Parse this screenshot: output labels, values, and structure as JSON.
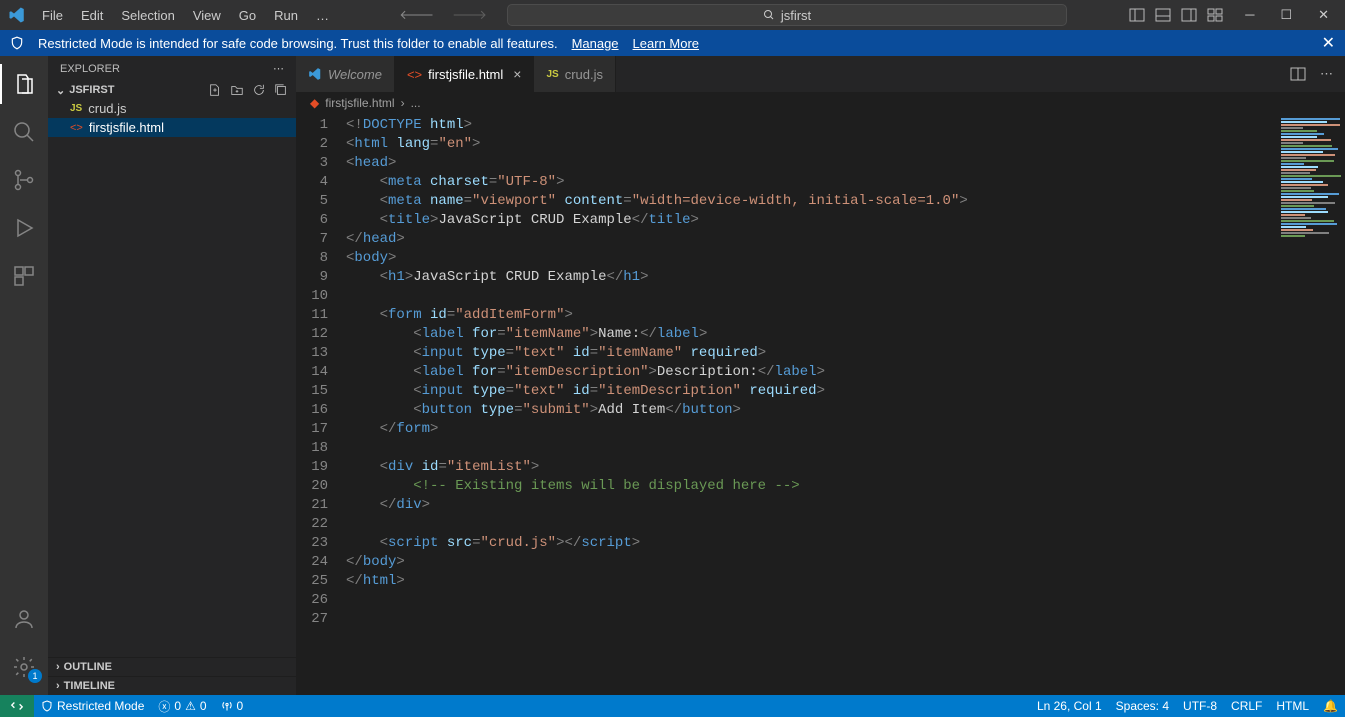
{
  "menu": {
    "items": [
      "File",
      "Edit",
      "Selection",
      "View",
      "Go",
      "Run",
      "…"
    ]
  },
  "title_search": "jsfirst",
  "banner": {
    "message": "Restricted Mode is intended for safe code browsing. Trust this folder to enable all features.",
    "link1": "Manage",
    "link2": "Learn More"
  },
  "sidebar": {
    "title": "EXPLORER",
    "project": "JSFIRST",
    "files": [
      {
        "name": "crud.js",
        "type": "js",
        "selected": false
      },
      {
        "name": "firstjsfile.html",
        "type": "html",
        "selected": true
      }
    ],
    "outline": "OUTLINE",
    "timeline": "TIMELINE"
  },
  "tabs": [
    {
      "label": "Welcome",
      "type": "welcome",
      "active": false,
      "close": false
    },
    {
      "label": "firstjsfile.html",
      "type": "html",
      "active": true,
      "close": true
    },
    {
      "label": "crud.js",
      "type": "js",
      "active": false,
      "close": false
    }
  ],
  "breadcrumb": {
    "file": "firstjsfile.html",
    "sep": "›",
    "dots": "..."
  },
  "code_lines": [
    [
      [
        "punc",
        "<!"
      ],
      [
        "tag",
        "DOCTYPE"
      ],
      [
        "text",
        " "
      ],
      [
        "attr",
        "html"
      ],
      [
        "punc",
        ">"
      ]
    ],
    [
      [
        "punc",
        "<"
      ],
      [
        "tag",
        "html"
      ],
      [
        "text",
        " "
      ],
      [
        "attr",
        "lang"
      ],
      [
        "punc",
        "="
      ],
      [
        "str",
        "\"en\""
      ],
      [
        "punc",
        ">"
      ]
    ],
    [
      [
        "punc",
        "<"
      ],
      [
        "tag",
        "head"
      ],
      [
        "punc",
        ">"
      ]
    ],
    [
      [
        "text",
        "    "
      ],
      [
        "punc",
        "<"
      ],
      [
        "tag",
        "meta"
      ],
      [
        "text",
        " "
      ],
      [
        "attr",
        "charset"
      ],
      [
        "punc",
        "="
      ],
      [
        "str",
        "\"UTF-8\""
      ],
      [
        "punc",
        ">"
      ]
    ],
    [
      [
        "text",
        "    "
      ],
      [
        "punc",
        "<"
      ],
      [
        "tag",
        "meta"
      ],
      [
        "text",
        " "
      ],
      [
        "attr",
        "name"
      ],
      [
        "punc",
        "="
      ],
      [
        "str",
        "\"viewport\""
      ],
      [
        "text",
        " "
      ],
      [
        "attr",
        "content"
      ],
      [
        "punc",
        "="
      ],
      [
        "str",
        "\"width=device-width, initial-scale=1.0\""
      ],
      [
        "punc",
        ">"
      ]
    ],
    [
      [
        "text",
        "    "
      ],
      [
        "punc",
        "<"
      ],
      [
        "tag",
        "title"
      ],
      [
        "punc",
        ">"
      ],
      [
        "text",
        "JavaScript CRUD Example"
      ],
      [
        "punc",
        "</"
      ],
      [
        "tag",
        "title"
      ],
      [
        "punc",
        ">"
      ]
    ],
    [
      [
        "punc",
        "</"
      ],
      [
        "tag",
        "head"
      ],
      [
        "punc",
        ">"
      ]
    ],
    [
      [
        "punc",
        "<"
      ],
      [
        "tag",
        "body"
      ],
      [
        "punc",
        ">"
      ]
    ],
    [
      [
        "text",
        "    "
      ],
      [
        "punc",
        "<"
      ],
      [
        "tag",
        "h1"
      ],
      [
        "punc",
        ">"
      ],
      [
        "text",
        "JavaScript CRUD Example"
      ],
      [
        "punc",
        "</"
      ],
      [
        "tag",
        "h1"
      ],
      [
        "punc",
        ">"
      ]
    ],
    [],
    [
      [
        "text",
        "    "
      ],
      [
        "punc",
        "<"
      ],
      [
        "tag",
        "form"
      ],
      [
        "text",
        " "
      ],
      [
        "attr",
        "id"
      ],
      [
        "punc",
        "="
      ],
      [
        "str",
        "\"addItemForm\""
      ],
      [
        "punc",
        ">"
      ]
    ],
    [
      [
        "text",
        "        "
      ],
      [
        "punc",
        "<"
      ],
      [
        "tag",
        "label"
      ],
      [
        "text",
        " "
      ],
      [
        "attr",
        "for"
      ],
      [
        "punc",
        "="
      ],
      [
        "str",
        "\"itemName\""
      ],
      [
        "punc",
        ">"
      ],
      [
        "text",
        "Name:"
      ],
      [
        "punc",
        "</"
      ],
      [
        "tag",
        "label"
      ],
      [
        "punc",
        ">"
      ]
    ],
    [
      [
        "text",
        "        "
      ],
      [
        "punc",
        "<"
      ],
      [
        "tag",
        "input"
      ],
      [
        "text",
        " "
      ],
      [
        "attr",
        "type"
      ],
      [
        "punc",
        "="
      ],
      [
        "str",
        "\"text\""
      ],
      [
        "text",
        " "
      ],
      [
        "attr",
        "id"
      ],
      [
        "punc",
        "="
      ],
      [
        "str",
        "\"itemName\""
      ],
      [
        "text",
        " "
      ],
      [
        "attr",
        "required"
      ],
      [
        "punc",
        ">"
      ]
    ],
    [
      [
        "text",
        "        "
      ],
      [
        "punc",
        "<"
      ],
      [
        "tag",
        "label"
      ],
      [
        "text",
        " "
      ],
      [
        "attr",
        "for"
      ],
      [
        "punc",
        "="
      ],
      [
        "str",
        "\"itemDescription\""
      ],
      [
        "punc",
        ">"
      ],
      [
        "text",
        "Description:"
      ],
      [
        "punc",
        "</"
      ],
      [
        "tag",
        "label"
      ],
      [
        "punc",
        ">"
      ]
    ],
    [
      [
        "text",
        "        "
      ],
      [
        "punc",
        "<"
      ],
      [
        "tag",
        "input"
      ],
      [
        "text",
        " "
      ],
      [
        "attr",
        "type"
      ],
      [
        "punc",
        "="
      ],
      [
        "str",
        "\"text\""
      ],
      [
        "text",
        " "
      ],
      [
        "attr",
        "id"
      ],
      [
        "punc",
        "="
      ],
      [
        "str",
        "\"itemDescription\""
      ],
      [
        "text",
        " "
      ],
      [
        "attr",
        "required"
      ],
      [
        "punc",
        ">"
      ]
    ],
    [
      [
        "text",
        "        "
      ],
      [
        "punc",
        "<"
      ],
      [
        "tag",
        "button"
      ],
      [
        "text",
        " "
      ],
      [
        "attr",
        "type"
      ],
      [
        "punc",
        "="
      ],
      [
        "str",
        "\"submit\""
      ],
      [
        "punc",
        ">"
      ],
      [
        "text",
        "Add Item"
      ],
      [
        "punc",
        "</"
      ],
      [
        "tag",
        "button"
      ],
      [
        "punc",
        ">"
      ]
    ],
    [
      [
        "text",
        "    "
      ],
      [
        "punc",
        "</"
      ],
      [
        "tag",
        "form"
      ],
      [
        "punc",
        ">"
      ]
    ],
    [],
    [
      [
        "text",
        "    "
      ],
      [
        "punc",
        "<"
      ],
      [
        "tag",
        "div"
      ],
      [
        "text",
        " "
      ],
      [
        "attr",
        "id"
      ],
      [
        "punc",
        "="
      ],
      [
        "str",
        "\"itemList\""
      ],
      [
        "punc",
        ">"
      ]
    ],
    [
      [
        "text",
        "        "
      ],
      [
        "cmt",
        "<!-- Existing items will be displayed here -->"
      ]
    ],
    [
      [
        "text",
        "    "
      ],
      [
        "punc",
        "</"
      ],
      [
        "tag",
        "div"
      ],
      [
        "punc",
        ">"
      ]
    ],
    [],
    [
      [
        "text",
        "    "
      ],
      [
        "punc",
        "<"
      ],
      [
        "tag",
        "script"
      ],
      [
        "text",
        " "
      ],
      [
        "attr",
        "src"
      ],
      [
        "punc",
        "="
      ],
      [
        "str",
        "\"crud.js\""
      ],
      [
        "punc",
        "></"
      ],
      [
        "tag",
        "script"
      ],
      [
        "punc",
        ">"
      ]
    ],
    [
      [
        "punc",
        "</"
      ],
      [
        "tag",
        "body"
      ],
      [
        "punc",
        ">"
      ]
    ],
    [
      [
        "punc",
        "</"
      ],
      [
        "tag",
        "html"
      ],
      [
        "punc",
        ">"
      ]
    ],
    [],
    []
  ],
  "statusbar": {
    "mode": "Restricted Mode",
    "errors": "0",
    "warnings": "0",
    "ports": "0",
    "position": "Ln 26, Col 1",
    "spaces": "Spaces: 4",
    "encoding": "UTF-8",
    "eol": "CRLF",
    "lang": "HTML"
  },
  "activity_badge": "1",
  "manage_badge": "1"
}
